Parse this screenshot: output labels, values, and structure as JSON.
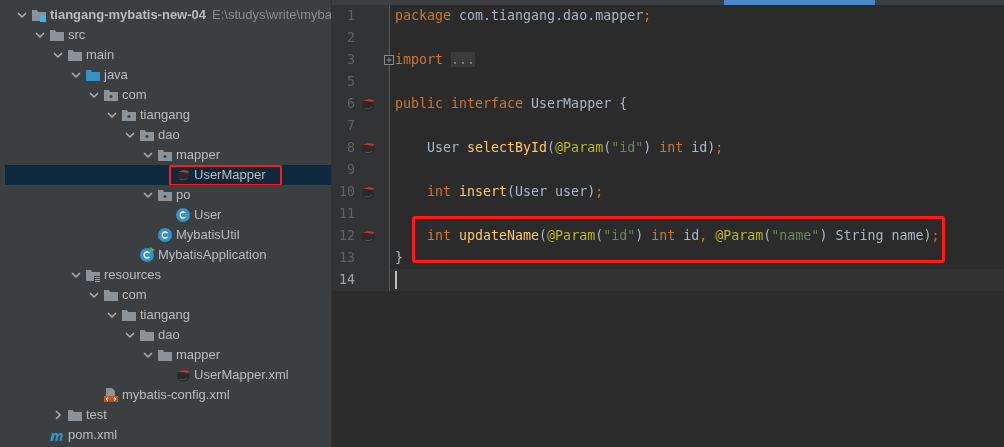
{
  "project_tree": {
    "label": "tiangang-mybatis-new-04",
    "detail": "E:\\studys\\write\\myba",
    "kind": "module",
    "expanded": true,
    "selected": false,
    "children": [
      {
        "label": "src",
        "kind": "folder",
        "expanded": true,
        "selected": false,
        "children": [
          {
            "label": "main",
            "kind": "folder",
            "expanded": true,
            "selected": false,
            "children": [
              {
                "label": "java",
                "kind": "source-folder",
                "expanded": true,
                "selected": false,
                "children": [
                  {
                    "label": "com",
                    "kind": "package",
                    "expanded": true,
                    "selected": false,
                    "children": [
                      {
                        "label": "tiangang",
                        "kind": "package",
                        "expanded": true,
                        "selected": false,
                        "children": [
                          {
                            "label": "dao",
                            "kind": "package",
                            "expanded": true,
                            "selected": false,
                            "children": [
                              {
                                "label": "mapper",
                                "kind": "package",
                                "expanded": true,
                                "selected": false,
                                "children": [
                                  {
                                    "label": "UserMapper",
                                    "kind": "mybatis",
                                    "selected": true,
                                    "annotated": true
                                  }
                                ]
                              },
                              {
                                "label": "po",
                                "kind": "package",
                                "expanded": true,
                                "selected": false,
                                "children": [
                                  {
                                    "label": "User",
                                    "kind": "class",
                                    "selected": false
                                  }
                                ]
                              },
                              {
                                "label": "MybatisUtil",
                                "kind": "class",
                                "selected": false
                              }
                            ]
                          },
                          {
                            "label": "MybatisApplication",
                            "kind": "app-class",
                            "selected": false
                          }
                        ]
                      }
                    ]
                  }
                ]
              },
              {
                "label": "resources",
                "kind": "resources",
                "expanded": true,
                "selected": false,
                "children": [
                  {
                    "label": "com",
                    "kind": "folder",
                    "expanded": true,
                    "selected": false,
                    "children": [
                      {
                        "label": "tiangang",
                        "kind": "folder",
                        "expanded": true,
                        "selected": false,
                        "children": [
                          {
                            "label": "dao",
                            "kind": "folder",
                            "expanded": true,
                            "selected": false,
                            "children": [
                              {
                                "label": "mapper",
                                "kind": "folder",
                                "expanded": true,
                                "selected": false,
                                "children": [
                                  {
                                    "label": "UserMapper.xml",
                                    "kind": "mybatis",
                                    "selected": false
                                  }
                                ]
                              }
                            ]
                          }
                        ]
                      }
                    ]
                  },
                  {
                    "label": "mybatis-config.xml",
                    "kind": "xml",
                    "selected": false
                  }
                ]
              }
            ]
          },
          {
            "label": "test",
            "kind": "folder",
            "expanded": false,
            "selected": false
          }
        ]
      },
      {
        "label": "pom.xml",
        "kind": "maven",
        "selected": false
      }
    ]
  },
  "editor": {
    "lines": [
      {
        "number": "1",
        "tokens": [
          {
            "text": "package ",
            "kind": "keyword"
          },
          {
            "text": "com.tiangang.dao.mapper",
            "kind": "plain"
          },
          {
            "text": ";",
            "kind": "keyword"
          }
        ]
      },
      {
        "number": "2"
      },
      {
        "number": "3",
        "folded": true,
        "tokens": [
          {
            "text": "import ",
            "kind": "keyword"
          },
          {
            "text": "...",
            "kind": "folded"
          }
        ]
      },
      {
        "number": "5"
      },
      {
        "number": "6",
        "gutter_icon": true,
        "tokens": [
          {
            "text": "public interface ",
            "kind": "keyword"
          },
          {
            "text": "UserMapper {",
            "kind": "plain"
          }
        ]
      },
      {
        "number": "7"
      },
      {
        "number": "8",
        "gutter_icon": true,
        "indent": true,
        "tokens": [
          {
            "text": "User ",
            "kind": "plain"
          },
          {
            "text": "selectById",
            "kind": "method"
          },
          {
            "text": "(",
            "kind": "plain"
          },
          {
            "text": "@Param",
            "kind": "annotation"
          },
          {
            "text": "(",
            "kind": "plain"
          },
          {
            "text": "\"id\"",
            "kind": "string"
          },
          {
            "text": ") ",
            "kind": "plain"
          },
          {
            "text": "int ",
            "kind": "keyword"
          },
          {
            "text": "id)",
            "kind": "plain"
          },
          {
            "text": ";",
            "kind": "keyword"
          }
        ]
      },
      {
        "number": "9"
      },
      {
        "number": "10",
        "gutter_icon": true,
        "indent": true,
        "tokens": [
          {
            "text": "int ",
            "kind": "keyword"
          },
          {
            "text": "insert",
            "kind": "method"
          },
          {
            "text": "(User user)",
            "kind": "plain"
          },
          {
            "text": ";",
            "kind": "keyword"
          }
        ]
      },
      {
        "number": "11"
      },
      {
        "number": "12",
        "gutter_icon": true,
        "indent": true,
        "annotated": true,
        "tokens": [
          {
            "text": "int ",
            "kind": "keyword"
          },
          {
            "text": "updateName",
            "kind": "method"
          },
          {
            "text": "(",
            "kind": "plain"
          },
          {
            "text": "@Param",
            "kind": "annotation"
          },
          {
            "text": "(",
            "kind": "plain"
          },
          {
            "text": "\"id\"",
            "kind": "string"
          },
          {
            "text": ") ",
            "kind": "plain"
          },
          {
            "text": "int ",
            "kind": "keyword"
          },
          {
            "text": "id",
            "kind": "plain"
          },
          {
            "text": ", ",
            "kind": "keyword"
          },
          {
            "text": "@Param",
            "kind": "annotation"
          },
          {
            "text": "(",
            "kind": "plain"
          },
          {
            "text": "\"name\"",
            "kind": "string"
          },
          {
            "text": ") String name)",
            "kind": "plain"
          },
          {
            "text": ";",
            "kind": "keyword"
          }
        ]
      },
      {
        "number": "13",
        "tokens": [
          {
            "text": "}",
            "kind": "plain"
          }
        ]
      },
      {
        "number": "14",
        "current": true
      }
    ]
  }
}
